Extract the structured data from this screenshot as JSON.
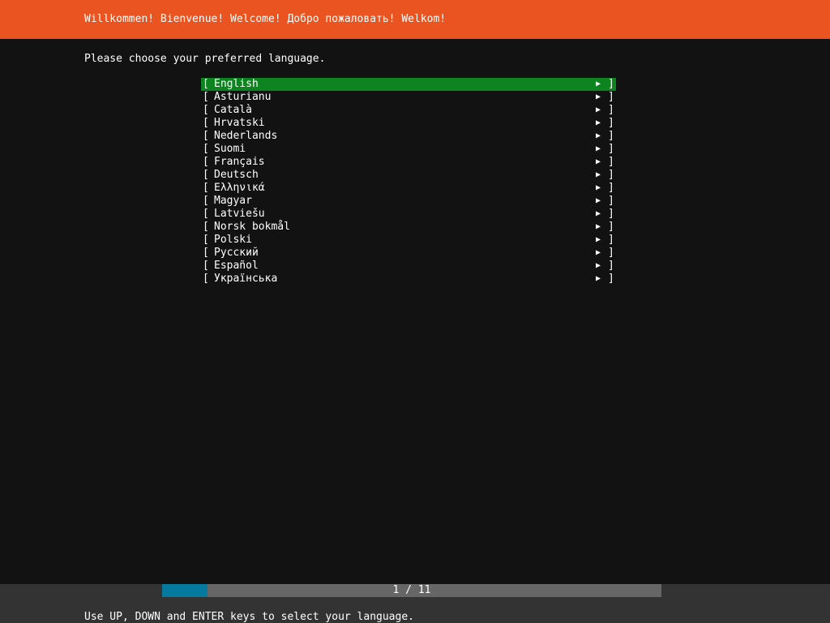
{
  "header": {
    "title": "Willkommen! Bienvenue! Welcome! Добро пожаловать! Welkom!",
    "background_color": "#e95420"
  },
  "instruction": "Please choose your preferred language.",
  "languages": {
    "selected_index": 0,
    "selected_color": "#0e8420",
    "bracket_open": "[",
    "bracket_close": "]",
    "arrow": "▶",
    "items": [
      {
        "label": "English"
      },
      {
        "label": "Asturianu"
      },
      {
        "label": "Català"
      },
      {
        "label": "Hrvatski"
      },
      {
        "label": "Nederlands"
      },
      {
        "label": "Suomi"
      },
      {
        "label": "Français"
      },
      {
        "label": "Deutsch"
      },
      {
        "label": "Ελληνικά"
      },
      {
        "label": "Magyar"
      },
      {
        "label": "Latviešu"
      },
      {
        "label": "Norsk bokmål"
      },
      {
        "label": "Polski"
      },
      {
        "label": "Русский"
      },
      {
        "label": "Español"
      },
      {
        "label": "Українська"
      }
    ]
  },
  "footer": {
    "progress": {
      "current": 1,
      "total": 11,
      "text": "1 / 11",
      "fill_color": "#06799f",
      "track_color": "#666666"
    },
    "help": "Use UP, DOWN and ENTER keys to select your language."
  }
}
